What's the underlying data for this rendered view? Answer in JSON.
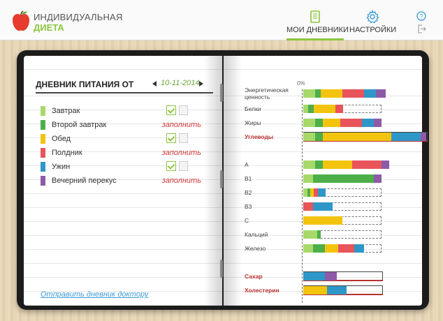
{
  "app": {
    "title_line1": "ИНДИВИДУАЛЬНАЯ",
    "title_line2": "ДИЕТА"
  },
  "nav": {
    "diaries_label": "МОИ ДНЕВНИКИ",
    "settings_label": "НАСТРОЙКИ"
  },
  "diary": {
    "title": "ДНЕВНИК ПИТАНИЯ ОТ",
    "date": "10-11-2014",
    "send_link": "Отправить дневник доктору",
    "meals": [
      {
        "name": "Завтрак",
        "color": "#a6d96a",
        "status": "done",
        "action": ""
      },
      {
        "name": "Второй завтрак",
        "color": "#4daf4a",
        "status": "empty",
        "action": "заполнить"
      },
      {
        "name": "Обед",
        "color": "#f2c40f",
        "status": "done",
        "action": ""
      },
      {
        "name": "Полдник",
        "color": "#e8545a",
        "status": "empty",
        "action": "заполнить"
      },
      {
        "name": "Ужин",
        "color": "#2e97c7",
        "status": "done",
        "action": ""
      },
      {
        "name": "Вечерний перекус",
        "color": "#8e5aa8",
        "status": "empty",
        "action": "заполнить"
      }
    ]
  },
  "nutrients": {
    "percent_label": "0%",
    "rows": [
      {
        "label": "Энергетическая ценность",
        "bold": false,
        "style": "segments",
        "segments": [
          0.12,
          0.06,
          0.22,
          0.22,
          0.12,
          0.1
        ],
        "target": 0.8
      },
      {
        "label": "Белки",
        "bold": false,
        "style": "segments",
        "segments": [
          0.05,
          0.06,
          0.22,
          0.08,
          0,
          0
        ],
        "target": 0.8
      },
      {
        "label": "Жиры",
        "bold": false,
        "style": "segments",
        "segments": [
          0.12,
          0.08,
          0.18,
          0.22,
          0.12,
          0.08
        ],
        "target": 0.8
      },
      {
        "label": "Углеводы",
        "bold": true,
        "style": "over",
        "segments": [
          0.12,
          0.08,
          0.7,
          0,
          0.3,
          0.06
        ],
        "target": 0.8
      },
      {
        "label": "A",
        "bold": false,
        "style": "segments",
        "segments": [
          0.12,
          0.08,
          0.3,
          0.3,
          0,
          0.08
        ],
        "target": 0.8
      },
      {
        "label": "B1",
        "bold": false,
        "style": "segments",
        "segments": [
          0.1,
          0.62,
          0,
          0,
          0,
          0.08
        ],
        "target": 0.8
      },
      {
        "label": "B2",
        "bold": false,
        "style": "segments",
        "segments": [
          0.04,
          0.03,
          0.04,
          0.04,
          0.08,
          0
        ],
        "target": 0.8
      },
      {
        "label": "B3",
        "bold": false,
        "style": "segments",
        "segments": [
          0,
          0,
          0,
          0.1,
          0.2,
          0
        ],
        "target": 0.8
      },
      {
        "label": "C",
        "bold": false,
        "style": "segments",
        "segments": [
          0,
          0,
          0.4,
          0,
          0,
          0
        ],
        "target": 0.8
      },
      {
        "label": "Кальций",
        "bold": false,
        "style": "segments",
        "segments": [
          0.14,
          0.04,
          0,
          0,
          0,
          0
        ],
        "target": 0.8
      },
      {
        "label": "Железо",
        "bold": false,
        "style": "segments",
        "segments": [
          0.1,
          0.12,
          0.14,
          0.16,
          0.1,
          0
        ],
        "target": 0.8
      },
      {
        "label": "Сахар",
        "bold": true,
        "style": "limit",
        "segments": [
          0,
          0,
          0,
          0,
          0.22,
          0.12
        ],
        "target": 0.8
      },
      {
        "label": "Холестерин",
        "bold": true,
        "style": "limit",
        "segments": [
          0,
          0,
          0.24,
          0,
          0.2,
          0
        ],
        "target": 0.8
      }
    ]
  },
  "colors": {
    "accent": "#8cc63f",
    "warning": "#d0393b",
    "link": "#3b9bd6"
  }
}
